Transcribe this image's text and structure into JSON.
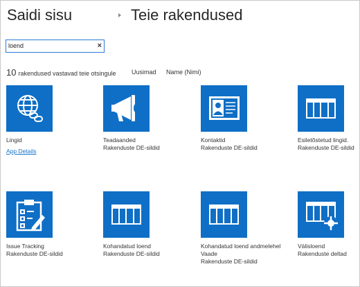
{
  "breadcrumb": {
    "site": "Saidi sisu",
    "page": "Teie rakendused"
  },
  "search": {
    "value": "loend",
    "clear_glyph": "×"
  },
  "results": {
    "count": "10",
    "text": "rakendused vastavad teie otsingule",
    "sort_newest": "Uusimad",
    "sort_name": "Name (Nimi)"
  },
  "apps": [
    {
      "name": "Lingid",
      "sub": "App Details",
      "icon": "globe-link-icon"
    },
    {
      "name": "Teadaanded",
      "sub": "Rakenduste DE-sildid",
      "icon": "megaphone-icon"
    },
    {
      "name": "Kontaktid",
      "sub": "Rakenduste DE-sildid",
      "icon": "contact-card-icon"
    },
    {
      "name": "Esiletõstetud lingid.",
      "sub": "Rakenduste DE-sildid",
      "icon": "table-icon"
    },
    {
      "name": "Issue Tracking",
      "sub": "Rakenduste DE-sildid",
      "icon": "clipboard-icon"
    },
    {
      "name": "Kohandatud loend",
      "sub": "Rakenduste DE-sildid",
      "icon": "table-icon"
    },
    {
      "name": "Kohandatud loend andmelehel",
      "name2": "Vaade",
      "sub": "Rakenduste DE-sildid",
      "icon": "table-icon"
    },
    {
      "name": "Välisloend",
      "sub": "Rakenduste deltad",
      "icon": "external-list-icon"
    }
  ],
  "colors": {
    "tile": "#0f6fc6",
    "link": "#1a73c9",
    "search_border": "#2b79d6"
  }
}
